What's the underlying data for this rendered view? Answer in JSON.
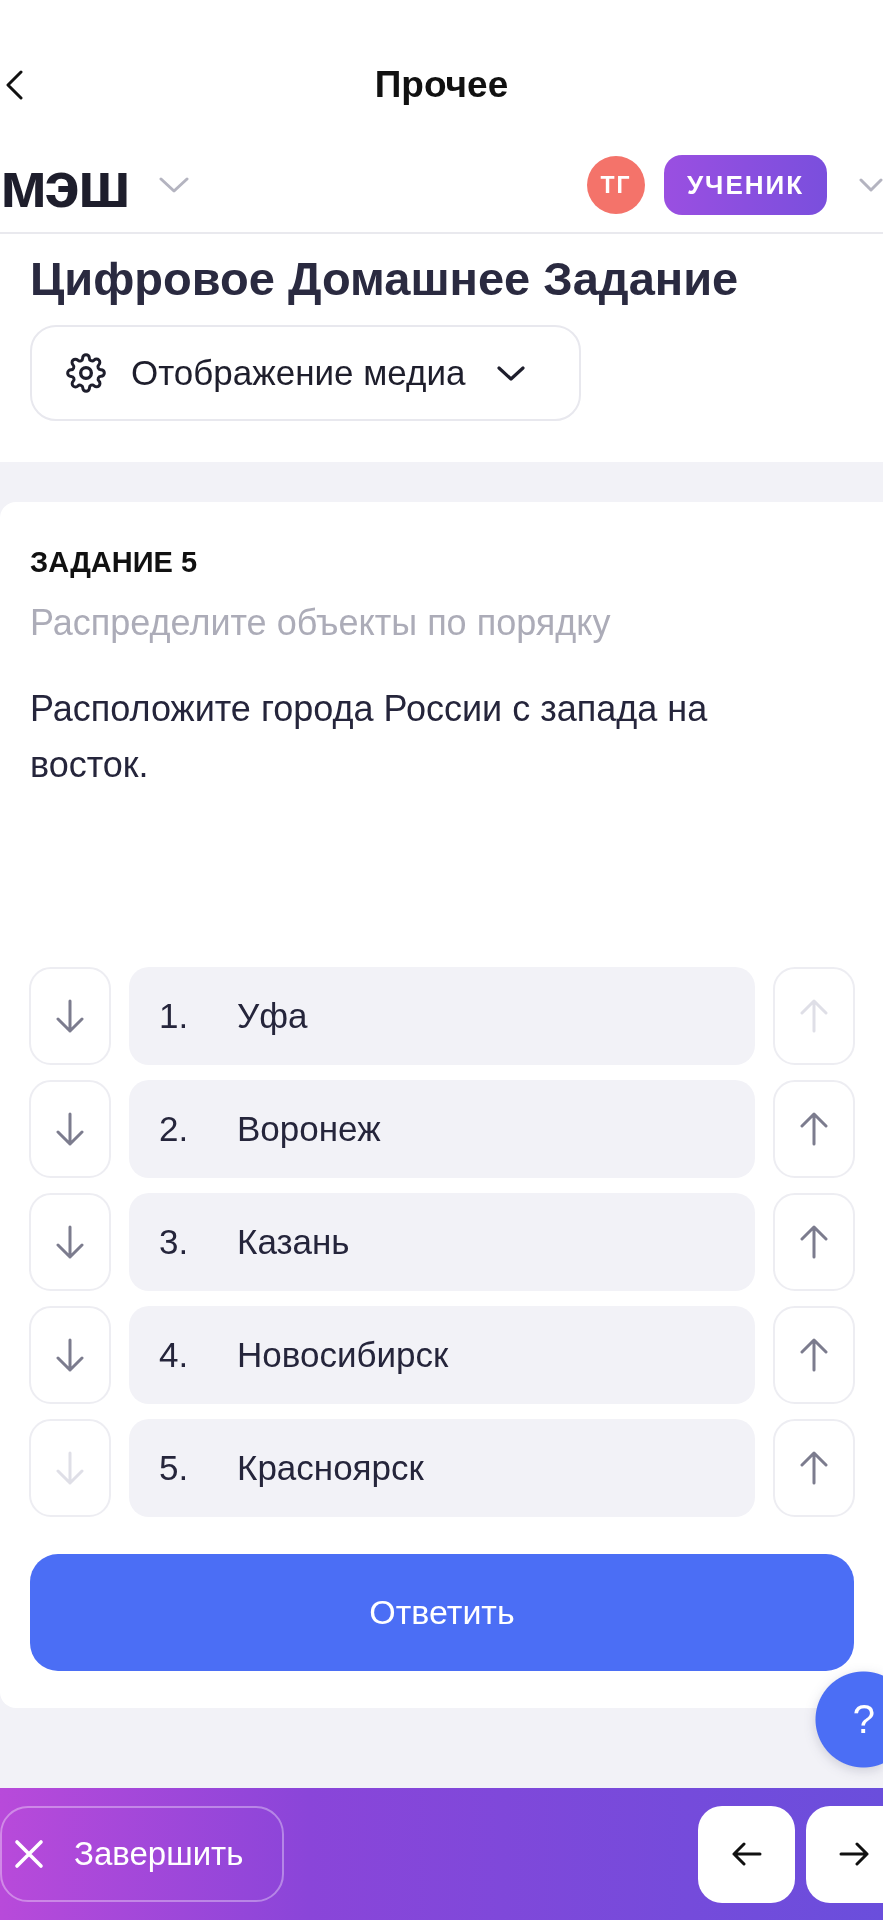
{
  "nav_bar": {
    "title": "Прочее"
  },
  "header": {
    "logo": "мэш",
    "avatar_initials": "ТГ",
    "role_badge": "УЧЕНИК"
  },
  "page_title": "Цифровое Домашнее Задание",
  "media_dropdown": {
    "label": "Отображение медиа"
  },
  "task": {
    "heading": "ЗАДАНИЕ 5",
    "instruction": "Распределите объекты по порядку",
    "question": "Расположите города России с запада на восток.",
    "items": [
      {
        "number": "1.",
        "label": "Уфа",
        "down_disabled": false,
        "up_disabled": true
      },
      {
        "number": "2.",
        "label": "Воронеж",
        "down_disabled": false,
        "up_disabled": false
      },
      {
        "number": "3.",
        "label": "Казань",
        "down_disabled": false,
        "up_disabled": false
      },
      {
        "number": "4.",
        "label": "Новосибирск",
        "down_disabled": false,
        "up_disabled": false
      },
      {
        "number": "5.",
        "label": "Красноярск",
        "down_disabled": true,
        "up_disabled": false
      }
    ],
    "answer_button": "Ответить"
  },
  "help_button": "?",
  "bottom_bar": {
    "finish_button": "Завершить"
  }
}
